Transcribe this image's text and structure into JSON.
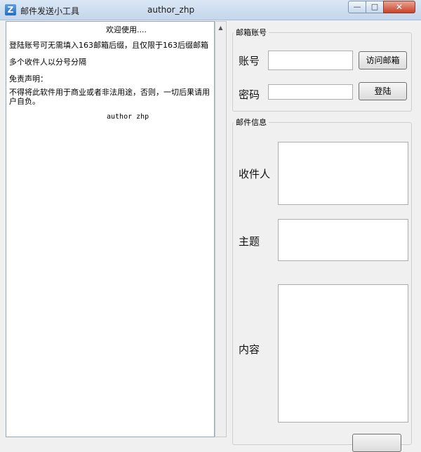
{
  "window": {
    "icon_glyph": "Z",
    "title": "邮件发送小工具",
    "author": "author_zhp",
    "minimize": "—",
    "maximize": "□",
    "close": "✕"
  },
  "info": {
    "welcome": "欢迎使用....",
    "line1": "登陆账号可无需填入163邮箱后缀，且仅限于163后缀邮箱",
    "line2": "多个收件人以分号分隔",
    "disclaimer_title": "免责声明：",
    "disclaimer_text": "不得将此软件用于商业或者非法用途，否则，一切后果请用户自负。",
    "author": "author zhp"
  },
  "account_group": {
    "title": "邮箱账号",
    "account_label": "账号",
    "account_value": "",
    "password_label": "密码",
    "password_value": "",
    "visit_button": "访问邮箱",
    "login_button": "登陆"
  },
  "mail_group": {
    "title": "邮件信息",
    "recipient_label": "收件人",
    "recipient_value": "",
    "subject_label": "主题",
    "subject_value": "",
    "content_label": "内容",
    "content_value": ""
  }
}
